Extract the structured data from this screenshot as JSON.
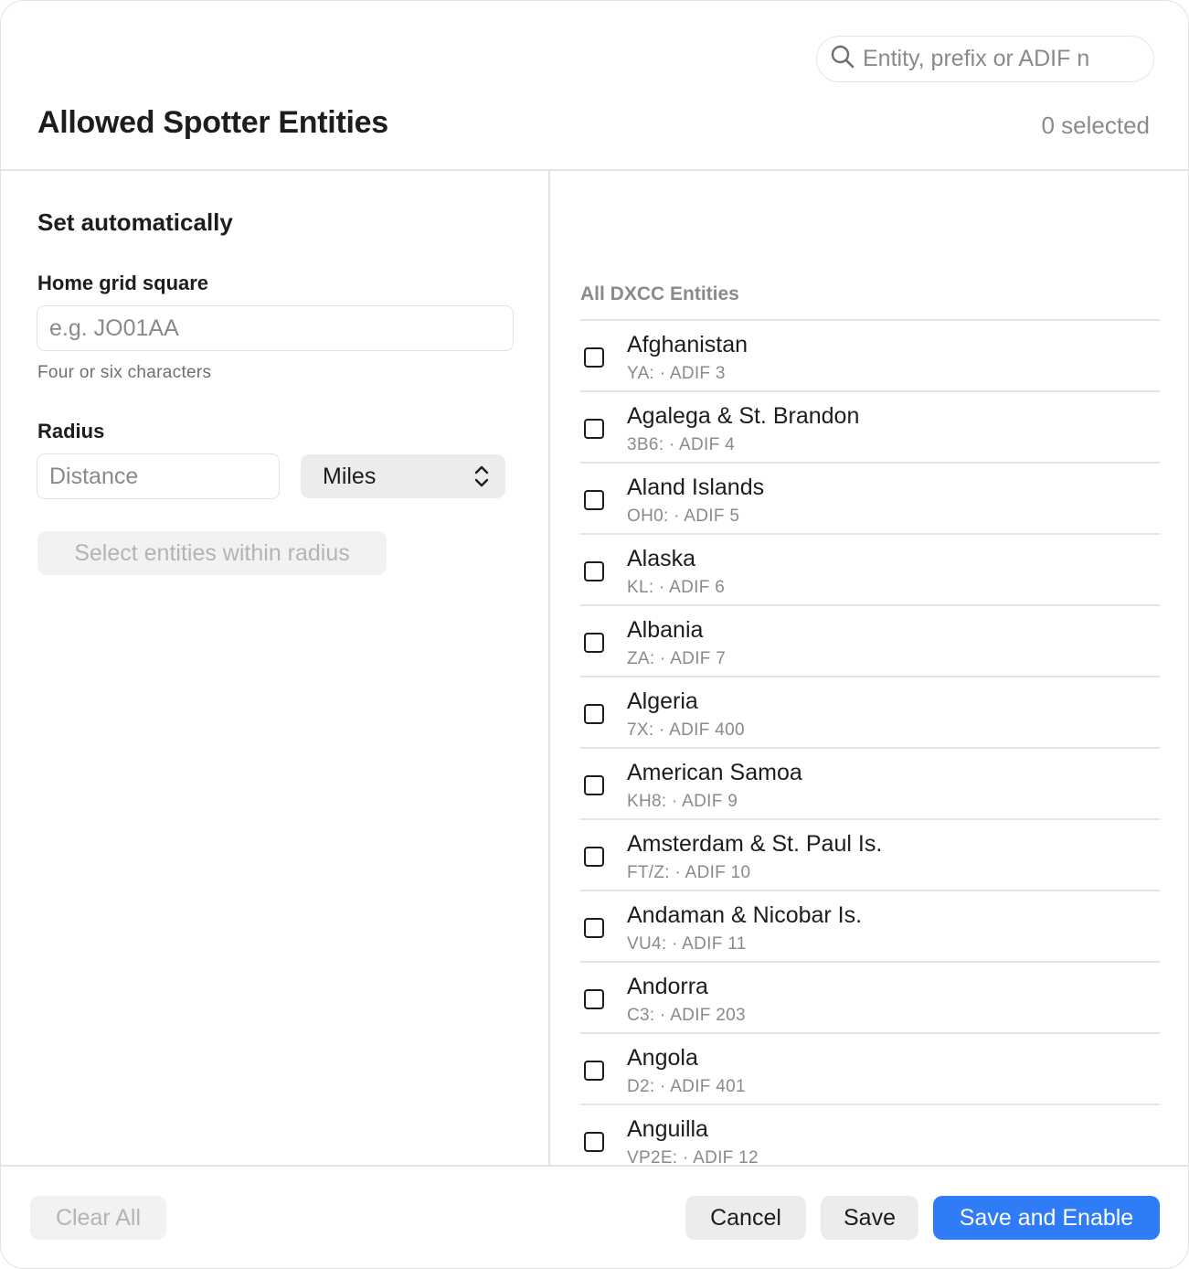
{
  "header": {
    "title": "Allowed Spotter Entities",
    "search_placeholder": "Entity, prefix or ADIF n",
    "selected_count": "0 selected"
  },
  "left_panel": {
    "section_title": "Set automatically",
    "grid_label": "Home grid square",
    "grid_placeholder": "e.g. JO01AA",
    "grid_hint": "Four or six characters",
    "radius_label": "Radius",
    "distance_placeholder": "Distance",
    "unit_selected": "Miles",
    "select_button": "Select entities within radius"
  },
  "list": {
    "header": "All DXCC Entities",
    "entities": [
      {
        "name": "Afghanistan",
        "meta": "YA: · ADIF 3"
      },
      {
        "name": "Agalega & St. Brandon",
        "meta": "3B6: · ADIF 4"
      },
      {
        "name": "Aland Islands",
        "meta": "OH0: · ADIF 5"
      },
      {
        "name": "Alaska",
        "meta": "KL: · ADIF 6"
      },
      {
        "name": "Albania",
        "meta": "ZA: · ADIF 7"
      },
      {
        "name": "Algeria",
        "meta": "7X: · ADIF 400"
      },
      {
        "name": "American Samoa",
        "meta": "KH8: · ADIF 9"
      },
      {
        "name": "Amsterdam & St. Paul Is.",
        "meta": "FT/Z: · ADIF 10"
      },
      {
        "name": "Andaman & Nicobar Is.",
        "meta": "VU4: · ADIF 11"
      },
      {
        "name": "Andorra",
        "meta": "C3: · ADIF 203"
      },
      {
        "name": "Angola",
        "meta": "D2: · ADIF 401"
      },
      {
        "name": "Anguilla",
        "meta": "VP2E: · ADIF 12"
      }
    ]
  },
  "footer": {
    "clear_all": "Clear All",
    "cancel": "Cancel",
    "save": "Save",
    "save_and_enable": "Save and Enable"
  },
  "colors": {
    "accent": "#2f7cf6",
    "secondary_text": "#8a8a8e",
    "divider": "#e3e3e3"
  }
}
